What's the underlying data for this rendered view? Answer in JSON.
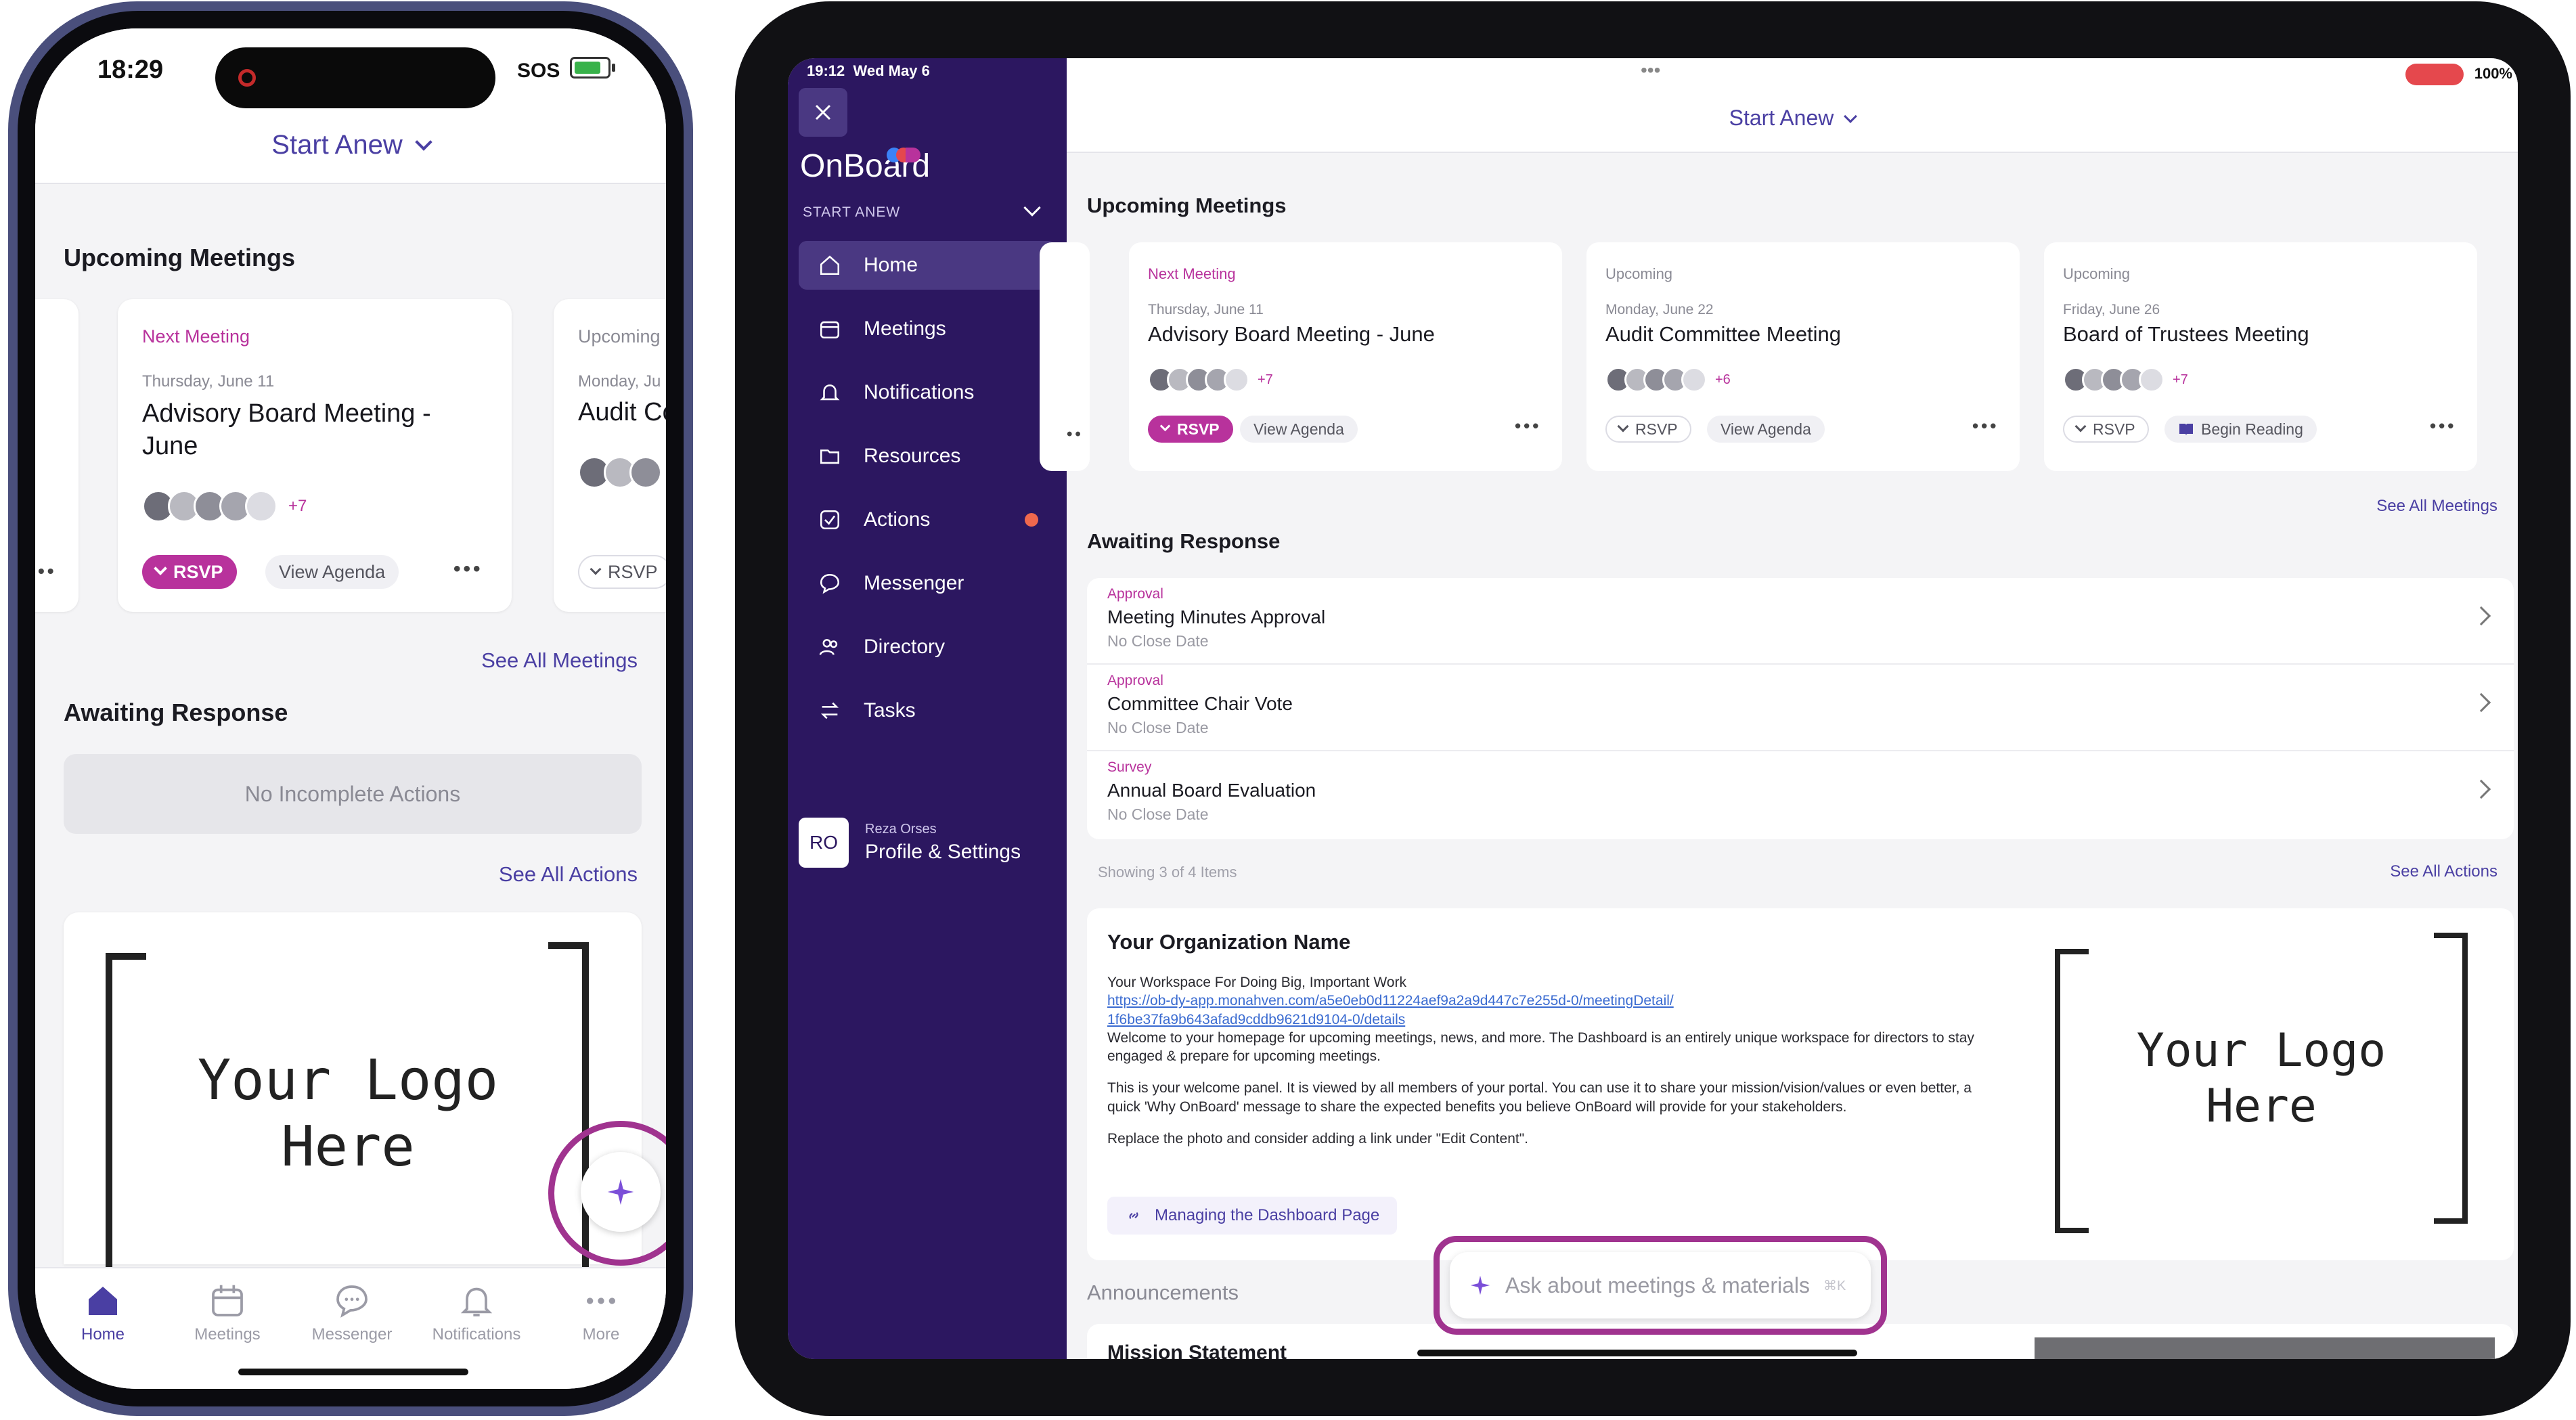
{
  "colors": {
    "brand_purple": "#4a3fa3",
    "sidebar": "#2c1760",
    "magenta": "#b8329c",
    "highlight_ring": "#a0338f"
  },
  "phone": {
    "status": {
      "time": "18:29",
      "signal": "SOS"
    },
    "workspace": "Start Anew",
    "upcoming_title": "Upcoming Meetings",
    "card1": {
      "label": "Next Meeting",
      "date": "Thursday, June 11",
      "title": "Advisory Board Meeting - June",
      "extra": "+7",
      "rsvp": "RSVP",
      "agenda": "View Agenda",
      "more": "•••"
    },
    "card2": {
      "label": "Upcoming",
      "date": "Monday, Ju",
      "title": "Audit Co",
      "rsvp": "RSVP"
    },
    "see_all_meetings": "See All Meetings",
    "awaiting_title": "Awaiting Response",
    "no_actions": "No Incomplete Actions",
    "see_all_actions": "See All Actions",
    "logo_line1": "Your Logo",
    "logo_line2": "Here",
    "tabs": [
      {
        "label": "Home",
        "icon": "home-icon"
      },
      {
        "label": "Meetings",
        "icon": "calendar-icon"
      },
      {
        "label": "Messenger",
        "icon": "chat-icon"
      },
      {
        "label": "Notifications",
        "icon": "bell-icon"
      },
      {
        "label": "More",
        "icon": "more-icon"
      }
    ]
  },
  "tablet": {
    "status": {
      "time": "19:12",
      "date": "Wed May 6",
      "battery": "100%"
    },
    "brand": "OnBoard",
    "org": "START ANEW",
    "workspace": "Start Anew",
    "nav": [
      {
        "label": "Home",
        "icon": "home-icon"
      },
      {
        "label": "Meetings",
        "icon": "calendar-icon"
      },
      {
        "label": "Notifications",
        "icon": "bell-icon"
      },
      {
        "label": "Resources",
        "icon": "folder-icon"
      },
      {
        "label": "Actions",
        "icon": "check-icon"
      },
      {
        "label": "Messenger",
        "icon": "chat-icon"
      },
      {
        "label": "Directory",
        "icon": "people-icon"
      },
      {
        "label": "Tasks",
        "icon": "swap-icon"
      }
    ],
    "profile": {
      "initials": "RO",
      "name": "Reza Orses",
      "label": "Profile & Settings"
    },
    "upcoming_title": "Upcoming Meetings",
    "meetings": [
      {
        "label": "Next Meeting",
        "date": "Thursday, June 11",
        "title": "Advisory Board Meeting - June",
        "extra": "+7",
        "rsvp": "RSVP",
        "secondary": "View Agenda"
      },
      {
        "label": "Upcoming",
        "date": "Monday, June 22",
        "title": "Audit Committee Meeting",
        "extra": "+6",
        "rsvp": "RSVP",
        "secondary": "View Agenda"
      },
      {
        "label": "Upcoming",
        "date": "Friday, June 26",
        "title": "Board of Trustees Meeting",
        "extra": "+7",
        "rsvp": "RSVP",
        "secondary": "Begin Reading"
      }
    ],
    "see_all_meetings": "See All Meetings",
    "awaiting_title": "Awaiting Response",
    "awaiting": [
      {
        "type": "Approval",
        "title": "Meeting Minutes Approval",
        "sub": "No Close Date"
      },
      {
        "type": "Approval",
        "title": "Committee Chair Vote",
        "sub": "No Close Date"
      },
      {
        "type": "Survey",
        "title": "Annual Board Evaluation",
        "sub": "No Close Date"
      }
    ],
    "showing": "Showing 3 of 4 Items",
    "see_all_actions": "See All Actions",
    "org_panel": {
      "title": "Your Organization Name",
      "tagline": "Your Workspace For Doing Big, Important Work",
      "url1": "https://ob-dy-app.monahven.com/a5e0eb0d11224aef9a2a9d447c7e255d-0/meetingDetail/",
      "url2": "1f6be37fa9b643afad9cddb9621d9104-0/details",
      "p1": "Welcome to your homepage for upcoming meetings, news, and more. The Dashboard is an entirely unique workspace for directors to stay engaged & prepare for upcoming meetings.",
      "p2": "This is your welcome panel. It is viewed by all members of your portal. You can use it to share your mission/vision/values or even better, a quick 'Why OnBoard' message to share the expected benefits you believe OnBoard will provide for your stakeholders.",
      "p3": "Replace the photo and consider adding a link under \"Edit Content\".",
      "link": "Managing the Dashboard Page",
      "logo_line1": "Your Logo",
      "logo_line2": "Here"
    },
    "announcements": "Announcements",
    "mission": "Mission Statement",
    "ask_placeholder": "Ask about meetings & materials",
    "ask_shortcut": "⌘K"
  }
}
